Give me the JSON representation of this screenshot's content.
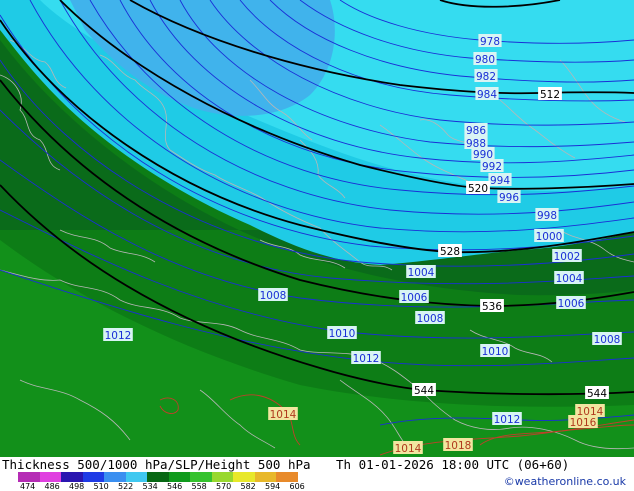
{
  "map": {
    "colors": {
      "zone_520_528": "#1fcbe6",
      "zone_512_520": "#35dcf0",
      "zone_504_512": "#40b3ec",
      "zone_528_536": "#0a6b1a",
      "zone_536_544": "#0d7d16",
      "zone_544_552": "#12901a",
      "isobar": "#1a2fd6",
      "height_contour": "#000000",
      "warm_isobar": "#c0402a",
      "coastline": "#b7b7b7"
    },
    "height_labels": [
      "512",
      "520",
      "528",
      "536",
      "544",
      "544"
    ],
    "slp_labels": [
      "978",
      "980",
      "982",
      "984",
      "986",
      "988",
      "990",
      "992",
      "994",
      "996",
      "998",
      "1000",
      "1002",
      "1004",
      "1004",
      "1006",
      "1006",
      "1008",
      "1008",
      "1008",
      "1010",
      "1010",
      "1012",
      "1012",
      "1012",
      "1014",
      "1014",
      "1014",
      "1016",
      "1018"
    ]
  },
  "footer": {
    "title": "Thickness 500/1000 hPa/SLP/Height 500 hPa",
    "datetime": "Th 01-01-2026 18:00 UTC (06+60)",
    "credit": "©weatheronline.co.uk",
    "legend_ticks": [
      "474",
      "486",
      "498",
      "510",
      "522",
      "534",
      "546",
      "558",
      "570",
      "582",
      "594",
      "606"
    ],
    "legend_colors": [
      "#b52cb5",
      "#e040e0",
      "#2a16b0",
      "#1f3be6",
      "#3b8ff0",
      "#40c8f0",
      "#086814",
      "#0f9a1c",
      "#35c22e",
      "#98d82e",
      "#e8e82a",
      "#e8b82a",
      "#e88a2a"
    ]
  }
}
